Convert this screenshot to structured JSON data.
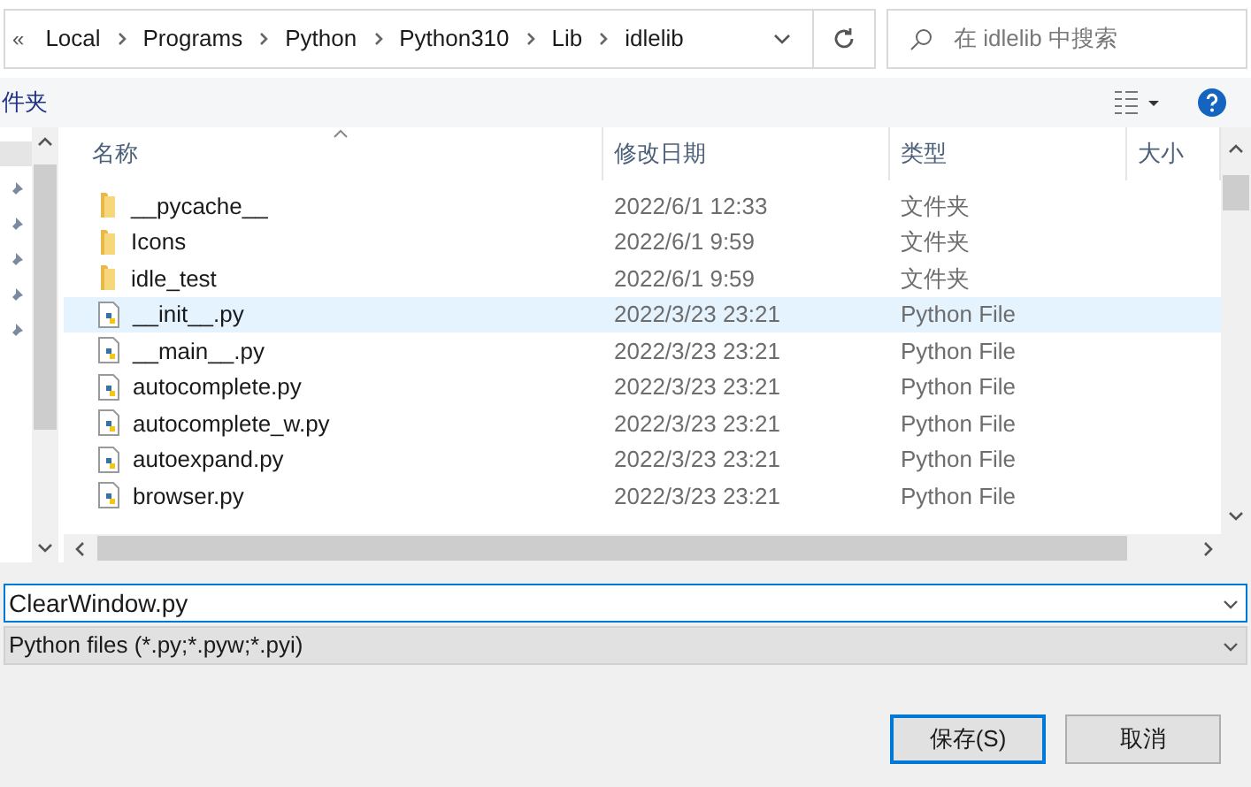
{
  "address_bar": {
    "overflow": "«",
    "crumbs": [
      "Local",
      "Programs",
      "Python",
      "Python310",
      "Lib",
      "idlelib"
    ]
  },
  "search": {
    "placeholder": "在 idlelib 中搜索"
  },
  "toolbar": {
    "new_folder": "件夹"
  },
  "table": {
    "columns": [
      {
        "label": "名称",
        "sorted": true
      },
      {
        "label": "修改日期",
        "sorted": false
      },
      {
        "label": "类型",
        "sorted": false
      },
      {
        "label": "大小",
        "sorted": false
      }
    ],
    "rows": [
      {
        "kind": "folder",
        "name": "__pycache__",
        "date": "2022/6/1 12:33",
        "type": "文件夹",
        "selected": false
      },
      {
        "kind": "folder",
        "name": "Icons",
        "date": "2022/6/1 9:59",
        "type": "文件夹",
        "selected": false
      },
      {
        "kind": "folder",
        "name": "idle_test",
        "date": "2022/6/1 9:59",
        "type": "文件夹",
        "selected": false
      },
      {
        "kind": "python",
        "name": "__init__.py",
        "date": "2022/3/23 23:21",
        "type": "Python File",
        "selected": true
      },
      {
        "kind": "python",
        "name": "__main__.py",
        "date": "2022/3/23 23:21",
        "type": "Python File",
        "selected": false
      },
      {
        "kind": "python",
        "name": "autocomplete.py",
        "date": "2022/3/23 23:21",
        "type": "Python File",
        "selected": false
      },
      {
        "kind": "python",
        "name": "autocomplete_w.py",
        "date": "2022/3/23 23:21",
        "type": "Python File",
        "selected": false
      },
      {
        "kind": "python",
        "name": "autoexpand.py",
        "date": "2022/3/23 23:21",
        "type": "Python File",
        "selected": false
      },
      {
        "kind": "python",
        "name": "browser.py",
        "date": "2022/3/23 23:21",
        "type": "Python File",
        "selected": false
      }
    ]
  },
  "file_name": {
    "value": "ClearWindow.py"
  },
  "file_type": {
    "value": "Python files (*.py;*.pyw;*.pyi)"
  },
  "buttons": [
    {
      "label": "保存(S)",
      "default": true
    },
    {
      "label": "取消",
      "default": false
    }
  ]
}
